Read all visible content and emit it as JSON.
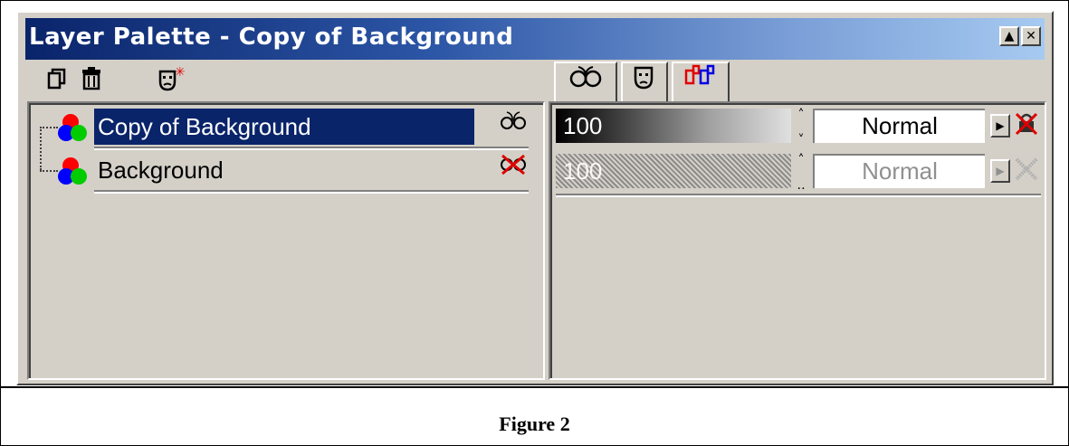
{
  "window": {
    "title": "Layer Palette - Copy of Background",
    "rollup_button": "▲",
    "close_button": "✕"
  },
  "toolbar": {
    "new_layer_icon": "new-layer-icon",
    "delete_layer_icon": "delete-layer-icon",
    "new_mask_icon": "new-mask-icon"
  },
  "tabs": [
    {
      "name": "layer-properties-tab",
      "icon": "glasses-icon",
      "active": true
    },
    {
      "name": "mask-tab",
      "icon": "mask-icon"
    },
    {
      "name": "channels-tab",
      "icon": "channels-icon"
    }
  ],
  "layers": [
    {
      "name": "Copy of Background",
      "selected": true,
      "visible": true,
      "opacity": "100",
      "blend_mode": "Normal",
      "enabled": true
    },
    {
      "name": "Background",
      "selected": false,
      "visible": false,
      "opacity": "100",
      "blend_mode": "Normal",
      "enabled": false
    }
  ],
  "caption": "Figure 2",
  "colors": {
    "title_start": "#0a246a",
    "title_end": "#a6caf0",
    "selected_row": "#0a246a",
    "panel_bg": "#d4d0c8",
    "red_x": "#e00000"
  }
}
